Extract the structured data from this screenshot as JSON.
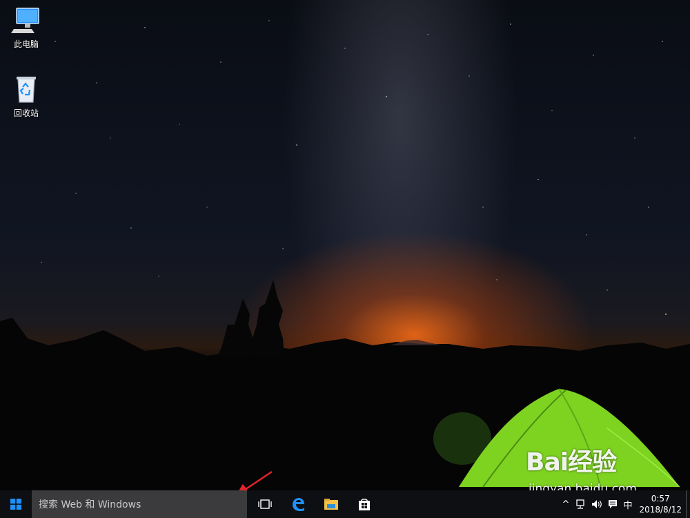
{
  "desktop": {
    "icons": [
      {
        "label": "此电脑",
        "icon": "computer-icon"
      },
      {
        "label": "回收站",
        "icon": "recycle-bin-icon"
      }
    ]
  },
  "taskbar": {
    "search_placeholder": "搜索 Web 和 Windows",
    "buttons": [
      {
        "icon": "task-view-icon"
      },
      {
        "icon": "edge-icon"
      },
      {
        "icon": "file-explorer-icon"
      },
      {
        "icon": "store-icon"
      }
    ],
    "tray": {
      "chevron": "^",
      "ime": "中",
      "time": "0:57",
      "date": "2018/8/12"
    }
  },
  "watermark": {
    "logo": "Bai经验",
    "url": "jingyan.baidu.com"
  },
  "colors": {
    "taskbar": "#0e0f12",
    "search": "#3b3b3d",
    "accent": "#1e90ff",
    "arrow": "#e0242a",
    "tent": "#7ed321"
  }
}
